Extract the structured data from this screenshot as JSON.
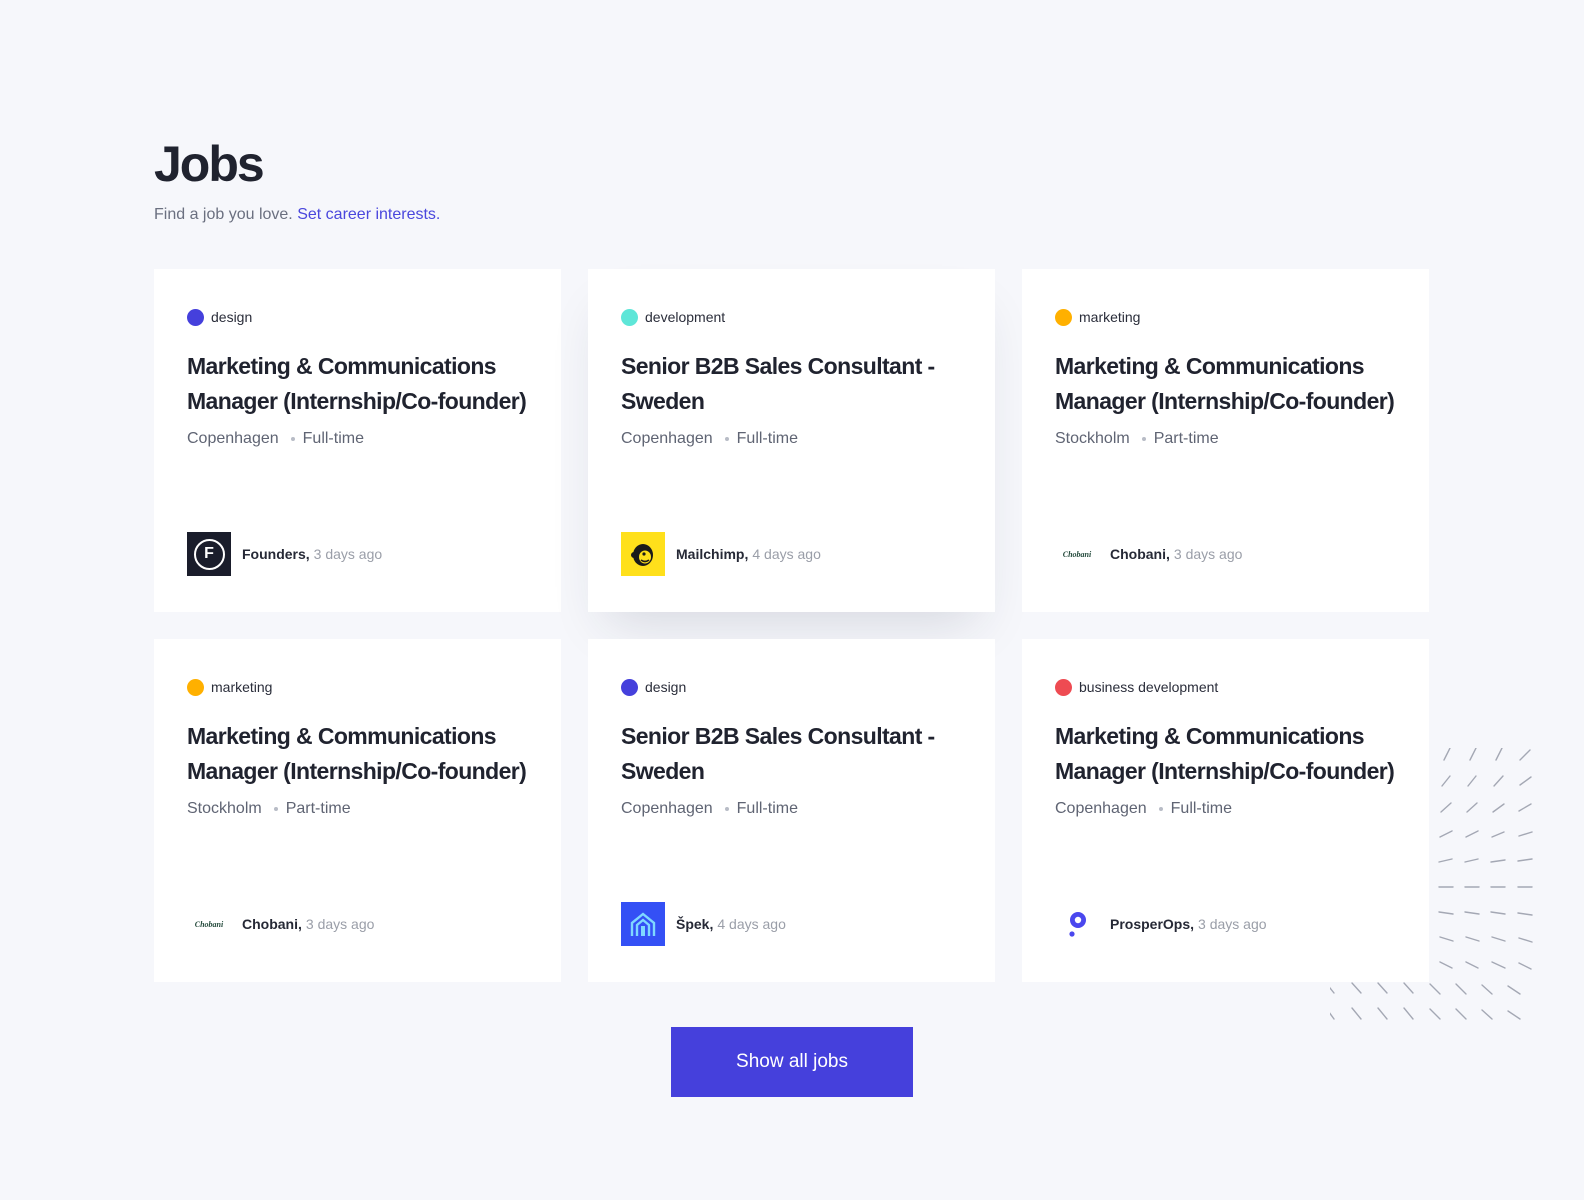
{
  "header": {
    "title": "Jobs",
    "subtitle": "Find a job you love.",
    "subtitle_link": "Set career interests."
  },
  "jobs": [
    {
      "category": "design",
      "category_color": "#4540dc",
      "title": "Marketing & Communications Manager (Internship/Co-founder)",
      "location": "Copenhagen",
      "type": "Full-time",
      "company": "Founders,",
      "posted": "3 days ago",
      "logo": "founders-logo"
    },
    {
      "category": "development",
      "category_color": "#5ee6d8",
      "title": "Senior B2B Sales Consultant - Sweden",
      "location": "Copenhagen",
      "type": "Full-time",
      "company": "Mailchimp,",
      "posted": "4 days ago",
      "logo": "mailchimp-logo"
    },
    {
      "category": "marketing",
      "category_color": "#ffb000",
      "title": "Marketing & Communications Manager (Internship/Co-founder)",
      "location": "Stockholm",
      "type": "Part-time",
      "company": "Chobani,",
      "posted": "3 days ago",
      "logo": "chobani-logo",
      "logo_text": "Chobani"
    },
    {
      "category": "marketing",
      "category_color": "#ffb000",
      "title": "Marketing & Communications Manager (Internship/Co-founder)",
      "location": "Stockholm",
      "type": "Part-time",
      "company": "Chobani,",
      "posted": "3 days ago",
      "logo": "chobani-logo",
      "logo_text": "Chobani"
    },
    {
      "category": "design",
      "category_color": "#4540dc",
      "title": "Senior B2B Sales Consultant - Sweden",
      "location": "Copenhagen",
      "type": "Full-time",
      "company": "Špek,",
      "posted": "4 days ago",
      "logo": "spek-logo"
    },
    {
      "category": "business development",
      "category_color": "#ee4b52",
      "title": "Marketing & Communications Manager (Internship/Co-founder)",
      "location": "Copenhagen",
      "type": "Full-time",
      "company": "ProsperOps,",
      "posted": "3 days ago",
      "logo": "prosperops-logo"
    }
  ],
  "actions": {
    "show_all": "Show all jobs"
  },
  "colors": {
    "background": "#f6f7fb",
    "accent": "#4540dc",
    "link": "#4a47dd"
  }
}
